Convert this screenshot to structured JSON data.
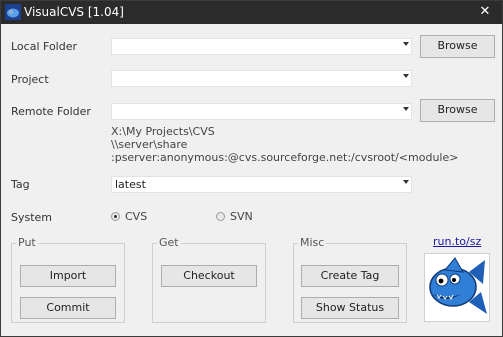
{
  "window": {
    "title": "VisualCVS [1.04]",
    "close_glyph": "✕",
    "app_icon": "visualcvs-app-icon"
  },
  "form": {
    "local_folder_label": "Local Folder",
    "local_folder_value": "",
    "project_label": "Project",
    "project_value": "",
    "remote_folder_label": "Remote Folder",
    "remote_folder_value": "",
    "browse_label": "Browse",
    "remote_examples": [
      "X:\\My Projects\\CVS",
      "\\\\server\\share",
      ":pserver:anonymous:@cvs.sourceforge.net:/cvsroot/<module>"
    ],
    "tag_label": "Tag",
    "tag_value": "latest",
    "system_label": "System",
    "system_options": [
      "CVS",
      "SVN"
    ],
    "system_selected": "CVS"
  },
  "groups": {
    "put": {
      "label": "Put",
      "buttons": [
        "Import",
        "Commit"
      ]
    },
    "get": {
      "label": "Get",
      "buttons": [
        "Checkout"
      ]
    },
    "misc": {
      "label": "Misc",
      "buttons": [
        "Create Tag",
        "Show Status"
      ]
    }
  },
  "link": {
    "text": "run.to/sz"
  },
  "colors": {
    "titlebar": "#2b2b2b",
    "accent_fish": "#2f7fd6",
    "link": "#1a1aa6"
  }
}
